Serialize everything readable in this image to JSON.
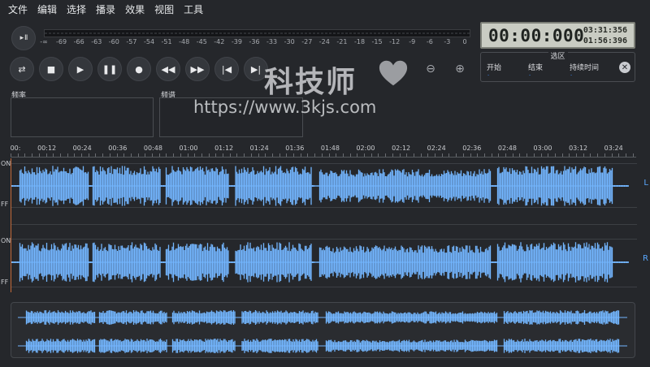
{
  "menu": [
    "文件",
    "编辑",
    "选择",
    "播录",
    "效果",
    "视图",
    "工具"
  ],
  "meter": {
    "button": "▸ II",
    "ticks": [
      "-∞",
      "-69",
      "-66",
      "-63",
      "-60",
      "-57",
      "-54",
      "-51",
      "-48",
      "-45",
      "-42",
      "-39",
      "-36",
      "-33",
      "-30",
      "-27",
      "-24",
      "-21",
      "-18",
      "-15",
      "-12",
      "-9",
      "-6",
      "-3",
      "0"
    ]
  },
  "time": {
    "main": "00:00:000",
    "total": "03:31:356",
    "selection": "01:56:396"
  },
  "transport": {
    "buttons": [
      {
        "name": "loop",
        "glyph": "⇄"
      },
      {
        "name": "stop",
        "glyph": "■"
      },
      {
        "name": "play",
        "glyph": "▶"
      },
      {
        "name": "pause",
        "glyph": "❚❚"
      },
      {
        "name": "record",
        "glyph": "●"
      },
      {
        "name": "rewind",
        "glyph": "◀◀"
      },
      {
        "name": "fast-forward",
        "glyph": "▶▶"
      },
      {
        "name": "skip-start",
        "glyph": "|◀"
      },
      {
        "name": "skip-end",
        "glyph": "▶|"
      }
    ]
  },
  "zoom": {
    "zoom_out": "⊖",
    "zoom_fit": "⊕"
  },
  "selection_box": {
    "title": "选区",
    "start_label": "开始",
    "end_label": "结束",
    "duration_label": "持续时间",
    "start_value": "-",
    "end_value": "-",
    "duration_value": "-",
    "close": "✕"
  },
  "panels": {
    "frequency": "频率",
    "spectrum": "频谱"
  },
  "watermark": {
    "text": "科技师",
    "url": "https://www.3kjs.com"
  },
  "ruler": [
    "00:",
    "00:12",
    "00:24",
    "00:36",
    "00:48",
    "01:00",
    "01:12",
    "01:24",
    "01:36",
    "01:48",
    "02:00",
    "02:12",
    "02:24",
    "02:36",
    "02:48",
    "03:00",
    "03:12",
    "03:24"
  ],
  "channels": {
    "left": "L",
    "right": "R",
    "on": "ON",
    "off": "FF"
  },
  "colors": {
    "wave": "#73b6ff",
    "accent": "#3d8bff",
    "playhead": "#c46a3a"
  }
}
